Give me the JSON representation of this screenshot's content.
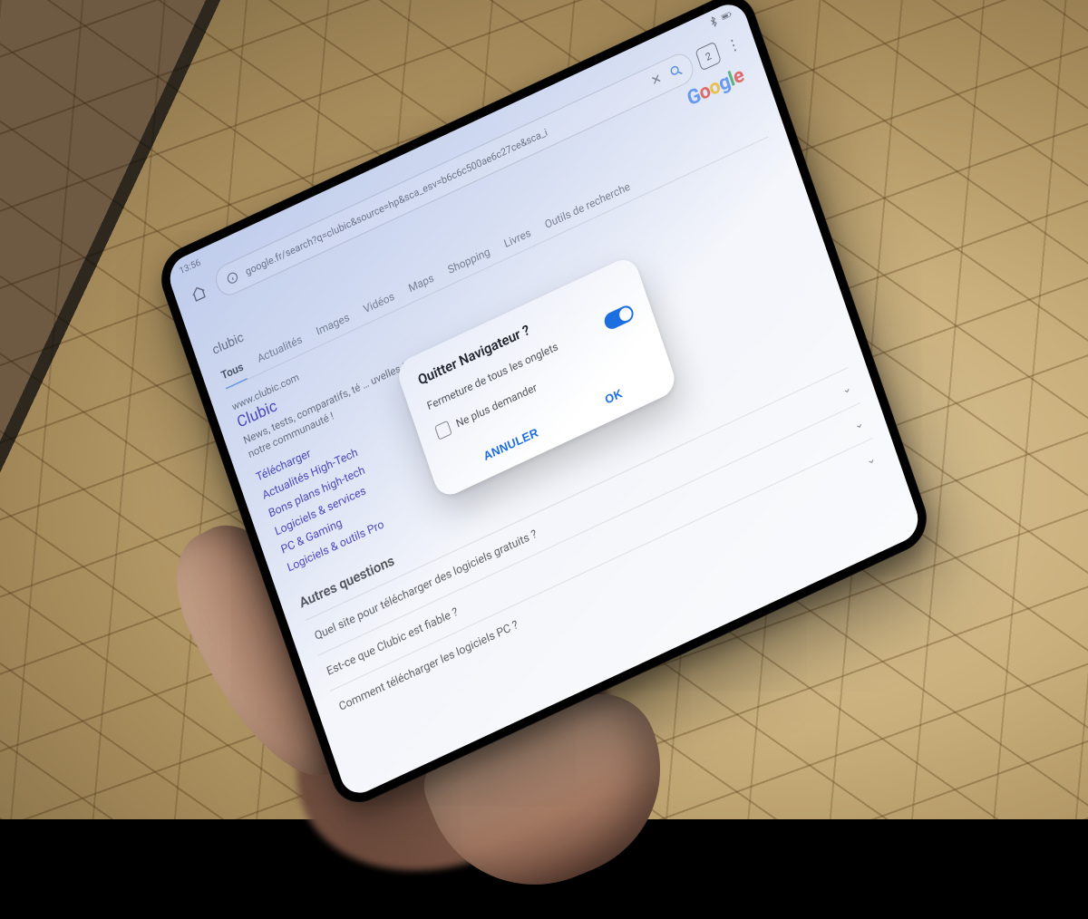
{
  "photo": {
    "subject": "foldable tablet held in left hand",
    "setting": "indoor, parquet wood floor, door frame visible top-left"
  },
  "statusbar": {
    "time": "13:56",
    "tab_count": "2"
  },
  "browser": {
    "url": "google.fr/search?q=clubic&source=hp&sca_esv=b6c6c500ae6c27ce&sca_i"
  },
  "search": {
    "logo": "Google",
    "query": "clubic",
    "tabs": [
      "Tous",
      "Actualités",
      "Images",
      "Vidéos",
      "Maps",
      "Shopping",
      "Livres",
      "Outils de recherche"
    ]
  },
  "result": {
    "site": "www.clubic.com",
    "title": "Clubic",
    "desc_prefix": "News, tests, comparatifs, té",
    "desc_suffix": "uvelles technologies avec",
    "desc_line2": "notre communauté !"
  },
  "sitelinks": [
    "Télécharger",
    "Actualités High-Tech",
    "Bons plans high-tech",
    "Logiciels & services",
    "PC & Gaming",
    "Logiciels & outils Pro"
  ],
  "paa": {
    "heading": "Autres questions",
    "items": [
      "Quel site pour télécharger des logiciels gratuits ?",
      "Est-ce que Clubic est fiable ?",
      "Comment télécharger les logiciels PC ?"
    ]
  },
  "dialog": {
    "title": "Quitter Navigateur ?",
    "subtitle": "Fermeture de tous les onglets",
    "toggle_on": true,
    "checkbox_label": "Ne plus demander",
    "cancel": "ANNULER",
    "ok": "OK"
  }
}
